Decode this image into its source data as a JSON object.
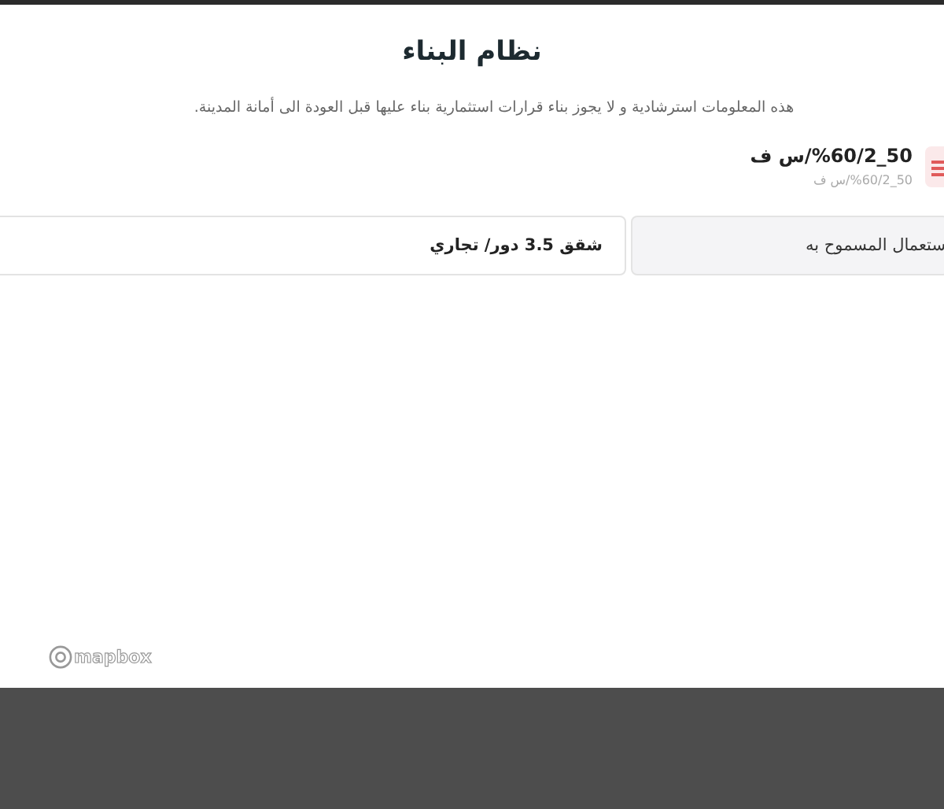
{
  "dialog": {
    "title": "نظام البناء",
    "notice": "هذه المعلومات استرشادية و لا يجوز بناء قرارات استثمارية بناء عليها قبل العودة الى أمانة المدينة.",
    "code": {
      "value": "50_2/%60/س ف",
      "subtitle": "50_2/%60/س ف"
    },
    "fields": [
      {
        "label": "ستعمال المسموح به",
        "value": "شقق 3.5 دور/ تجاري"
      }
    ]
  },
  "map_attribution": "mapbox"
}
